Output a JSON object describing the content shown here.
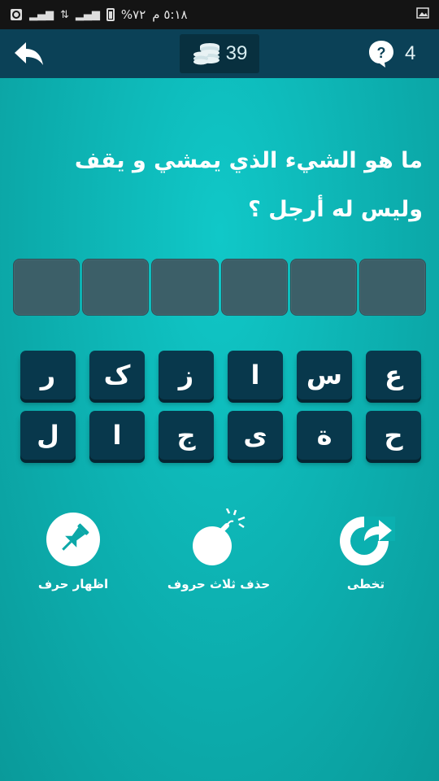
{
  "status_bar": {
    "time": "٥:١٨ م",
    "battery": "%٧٢",
    "icons": [
      "photo-icon",
      "battery-icon",
      "signal-icon",
      "data-icon",
      "signal-icon",
      "sync-icon"
    ]
  },
  "header": {
    "coins": "39",
    "level": "4",
    "icons": [
      "back-arrow-icon",
      "coins-icon",
      "help-icon"
    ]
  },
  "question": {
    "text": "ما هو الشيء الذي يمشي و يقف وليس له أرجل ؟"
  },
  "answer": {
    "slot_count": 6
  },
  "keyboard": {
    "row1": [
      "ع",
      "س",
      "ا",
      "ز",
      "ک",
      "ر"
    ],
    "row2": [
      "ح",
      "ة",
      "ى",
      "ج",
      "ا",
      "ل"
    ]
  },
  "powerups": {
    "reveal_label": "اظهار حرف",
    "remove_label": "حذف ثلاث حروف",
    "skip_label": "تخطى",
    "icons": [
      "pin-icon",
      "bomb-icon",
      "skip-arrow-icon"
    ]
  },
  "colors": {
    "background": "#0db3b3",
    "header": "#0b4157",
    "key": "#08384c",
    "slot": "#3c5f68"
  }
}
